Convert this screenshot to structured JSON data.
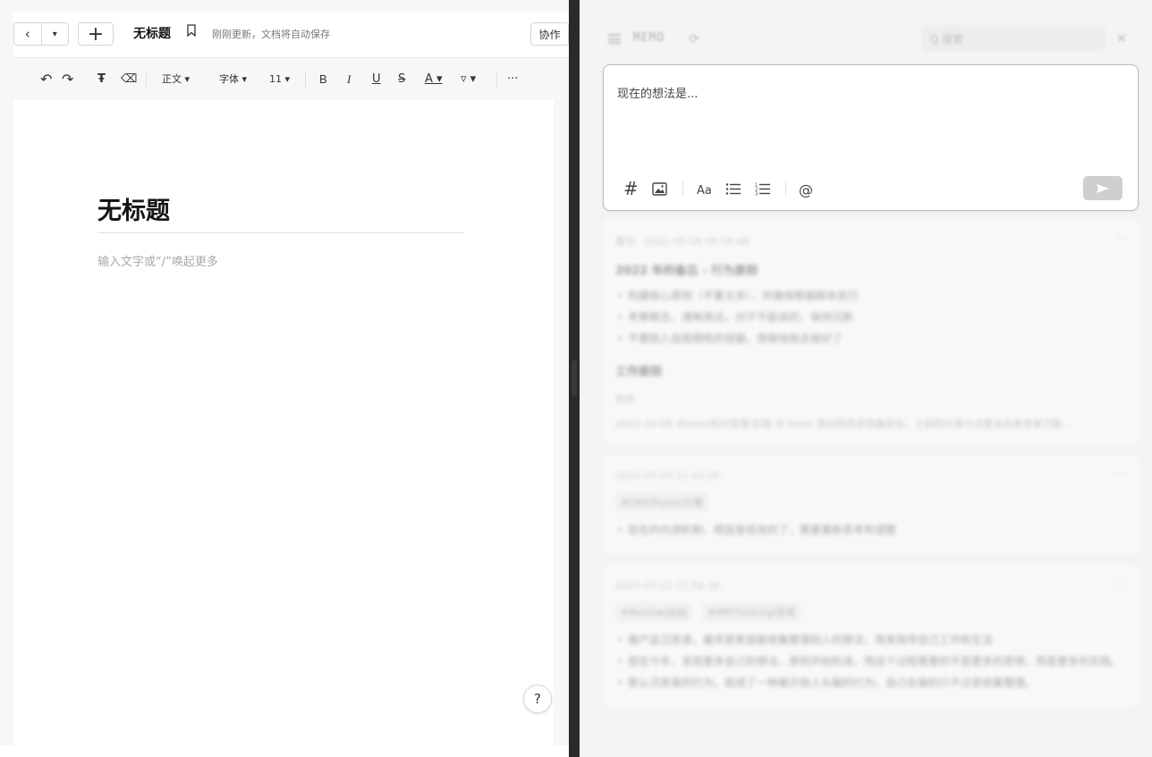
{
  "doc": {
    "title_short": "无标题",
    "save_status": "刚刚更新，文档将自动保存",
    "collab_label": "协作",
    "plus_label": "+",
    "back_icon": "‹",
    "dropdown_icon": "▾",
    "page_title": "无标题",
    "body_placeholder": "输入文字或“/”唤起更多",
    "help_label": "?"
  },
  "toolbar": {
    "undo": "↶",
    "redo": "↷",
    "format_painter": "Ŧ",
    "eraser": "⌫",
    "paragraph_style": "正文 ▾",
    "font": "字体 ▾",
    "font_size": "11 ▾",
    "bold": "B",
    "italic": "I",
    "underline": "U",
    "strike": "S",
    "font_color": "A ▾",
    "highlight": "▿ ▾",
    "more": "···"
  },
  "memo": {
    "header_title": "MEMO",
    "search_placeholder": "Q 搜索",
    "editor_placeholder": "现在的想法是...",
    "tools": {
      "tag": "#",
      "font_size": "Aa",
      "mention": "@"
    },
    "send_icon": "send-icon",
    "items": [
      {
        "meta": "置顶 · 2022-05-18 09:56:48",
        "heading": "2022 年的备忘 - 行为原则",
        "bullets": [
          "构建核心原则（不要太多），并确保根据脚本执行",
          "考察概念、清晰表达，对于不能说的，保持沉默",
          "不要陷入自我牺牲的怪圈，想做啥就去做好了"
        ],
        "heading2": "工作原则",
        "label": "相关",
        "ref": "2022-10-05 #Inner知识管理/实践 对 fumo 周边的改进思路变化，之前的分享方式更多的参考是沉默…"
      },
      {
        "meta": "2023-07-24 11:43:20",
        "tags": [
          "#OKR/Fumo/方案"
        ],
        "bullets": [
          "现在的内测机制，明显是低效的了，需要重新思考和调整"
        ]
      },
      {
        "meta": "2023-07-22 21:56:38",
        "tags": [
          "#Review/总结",
          "#PMThinking/思考"
        ],
        "bullets": [
          "做产品沉思录，最早是希望能收集整理别人的想法，用来指导自己工作和生活",
          "但在今年，发现更多自己的想法，原则开始形成，而这个过程需要的不是更多的思想，而是更多的实践。",
          "那么沉思录的行为，就成了一种展示他人头脑的行为，自己在做的只不过是收集整理。"
        ]
      }
    ]
  }
}
